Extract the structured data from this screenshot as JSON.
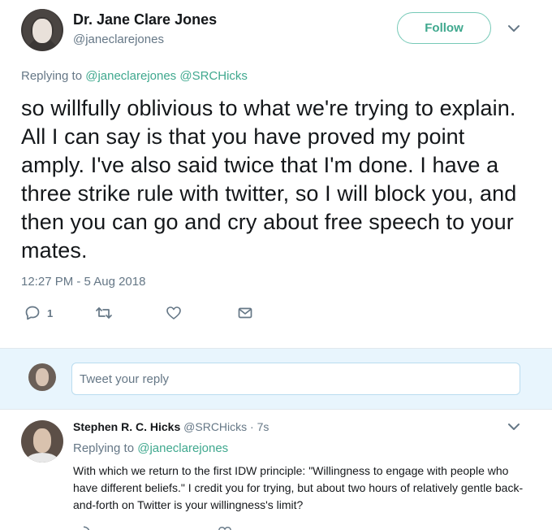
{
  "main_tweet": {
    "author_name": "Dr. Jane Clare Jones",
    "author_handle": "@janeclarejones",
    "follow_label": "Follow",
    "replying_prefix": "Replying to ",
    "replying_mentions": "@janeclarejones @SRCHicks",
    "text": "so willfully oblivious to what we're trying to explain. All I can say is that you have proved my point amply. I've also said twice that I'm done. I have a three strike rule with twitter, so I will block you, and then you can go and cry about free speech to your mates.",
    "timestamp": "12:27 PM - 5 Aug 2018",
    "reply_count": "1",
    "icons": [
      "reply-icon",
      "retweet-icon",
      "like-icon",
      "message-icon",
      "chevron-down-icon"
    ]
  },
  "reply_box": {
    "placeholder": "Tweet your reply"
  },
  "reply_tweet": {
    "author_name": "Stephen R. C. Hicks",
    "author_handle": "@SRCHicks",
    "time_ago": "· 7s",
    "replying_prefix": "Replying to ",
    "replying_mentions": "@janeclarejones",
    "text": "With which we return to the first IDW principle: \"Willingness to engage with people who have different beliefs.\" I credit you for trying, but about two hours of relatively gentle back-and-forth on Twitter is your willingness's limit?"
  },
  "colors": {
    "accent": "#3fa88e",
    "muted": "#657786",
    "text": "#14171a",
    "reply_bg": "#e8f5fd"
  }
}
